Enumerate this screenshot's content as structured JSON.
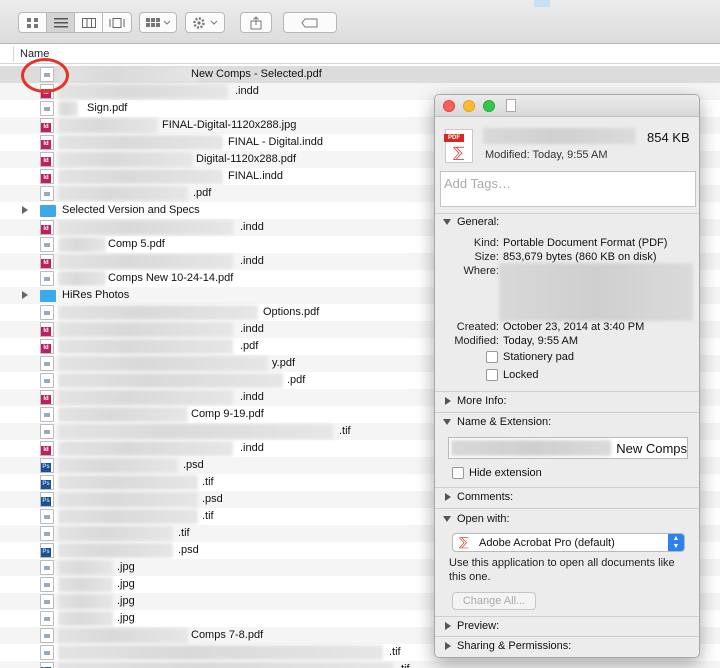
{
  "toolbar": {
    "view_modes": [
      "icon-view",
      "list-view",
      "column-view",
      "coverflow-view"
    ],
    "active_view": "list-view"
  },
  "columns": {
    "name_header": "Name"
  },
  "rows": [
    {
      "type": "pdf",
      "name": "New Comps - Selected.pdf",
      "blur_w": 140,
      "text_x": 191,
      "selected": true
    },
    {
      "type": "indd",
      "name": ".indd",
      "blur_w": 170,
      "text_x": 235
    },
    {
      "type": "pdf",
      "name": "Sign.pdf",
      "blur_w": 20,
      "text_x": 87
    },
    {
      "type": "indd",
      "name": "FINAL-Digital-1120x288.jpg",
      "blur_w": 100,
      "text_x": 162
    },
    {
      "type": "indd",
      "name": "FINAL - Digital.indd",
      "blur_w": 165,
      "text_x": 228
    },
    {
      "type": "indd",
      "name": "Digital-1120x288.pdf",
      "blur_w": 135,
      "text_x": 196
    },
    {
      "type": "indd",
      "name": "FINAL.indd",
      "blur_w": 165,
      "text_x": 228
    },
    {
      "type": "pdf",
      "name": ".pdf",
      "blur_w": 130,
      "text_x": 193
    },
    {
      "type": "folder",
      "name": "Selected Version and Specs",
      "blur_w": 0,
      "text_x": 62,
      "expandable": true
    },
    {
      "type": "indd",
      "name": ".indd",
      "blur_w": 175,
      "text_x": 240
    },
    {
      "type": "pdf",
      "name": "Comp 5.pdf",
      "blur_w": 48,
      "text_x": 108
    },
    {
      "type": "indd",
      "name": ".indd",
      "blur_w": 175,
      "text_x": 240
    },
    {
      "type": "pdf",
      "name": "Comps New 10-24-14.pdf",
      "blur_w": 48,
      "text_x": 108
    },
    {
      "type": "folder",
      "name": "HiRes Photos",
      "blur_w": 0,
      "text_x": 62,
      "expandable": true
    },
    {
      "type": "pdf",
      "name": "Options.pdf",
      "blur_w": 200,
      "text_x": 263
    },
    {
      "type": "indd",
      "name": ".indd",
      "blur_w": 175,
      "text_x": 240
    },
    {
      "type": "indd",
      "name": ".pdf",
      "blur_w": 175,
      "text_x": 240
    },
    {
      "type": "pdf",
      "name": "y.pdf",
      "blur_w": 210,
      "text_x": 272
    },
    {
      "type": "pdf",
      "name": ".pdf",
      "blur_w": 225,
      "text_x": 287
    },
    {
      "type": "indd",
      "name": ".indd",
      "blur_w": 175,
      "text_x": 240
    },
    {
      "type": "pdf",
      "name": "Comp 9-19.pdf",
      "blur_w": 130,
      "text_x": 191
    },
    {
      "type": "pdf",
      "name": ".tif",
      "blur_w": 275,
      "text_x": 339
    },
    {
      "type": "indd",
      "name": ".indd",
      "blur_w": 175,
      "text_x": 240
    },
    {
      "type": "psd",
      "name": ".psd",
      "blur_w": 120,
      "text_x": 183
    },
    {
      "type": "psd",
      "name": ".tif",
      "blur_w": 140,
      "text_x": 202
    },
    {
      "type": "psd",
      "name": ".psd",
      "blur_w": 140,
      "text_x": 202
    },
    {
      "type": "pdf",
      "name": ".tif",
      "blur_w": 140,
      "text_x": 202
    },
    {
      "type": "pdf",
      "name": ".tif",
      "blur_w": 115,
      "text_x": 178
    },
    {
      "type": "psd",
      "name": ".psd",
      "blur_w": 115,
      "text_x": 178
    },
    {
      "type": "pdf",
      "name": ".jpg",
      "blur_w": 55,
      "text_x": 117
    },
    {
      "type": "pdf",
      "name": ".jpg",
      "blur_w": 55,
      "text_x": 117
    },
    {
      "type": "pdf",
      "name": ".jpg",
      "blur_w": 55,
      "text_x": 117
    },
    {
      "type": "pdf",
      "name": ".jpg",
      "blur_w": 55,
      "text_x": 117
    },
    {
      "type": "pdf",
      "name": "Comps 7-8.pdf",
      "blur_w": 130,
      "text_x": 191
    },
    {
      "type": "pdf",
      "name": ".tif",
      "blur_w": 325,
      "text_x": 389
    },
    {
      "type": "psd",
      "name": ".tif",
      "blur_w": 335,
      "text_x": 398
    }
  ],
  "info_panel": {
    "file_size": "854 KB",
    "modified": "Modified: Today, 9:55 AM",
    "tags_placeholder": "Add Tags…",
    "sections": {
      "general": "General:",
      "more_info": "More Info:",
      "name_ext": "Name & Extension:",
      "comments": "Comments:",
      "open_with": "Open with:",
      "preview": "Preview:",
      "sharing": "Sharing & Permissions:"
    },
    "general": {
      "kind_label": "Kind:",
      "kind": "Portable Document Format (PDF)",
      "size_label": "Size:",
      "size": "853,679 bytes (860 KB on disk)",
      "where_label": "Where:",
      "created_label": "Created:",
      "created": "October 23, 2014 at 3:40 PM",
      "modified_label": "Modified:",
      "modified": "Today, 9:55 AM",
      "stationery": "Stationery pad",
      "locked": "Locked"
    },
    "name_field_value": "New Comps",
    "hide_extension": "Hide extension",
    "open_with_app": "Adobe Acrobat Pro (default)",
    "use_app_text": "Use this application to open all documents like this one.",
    "change_all": "Change All..."
  }
}
